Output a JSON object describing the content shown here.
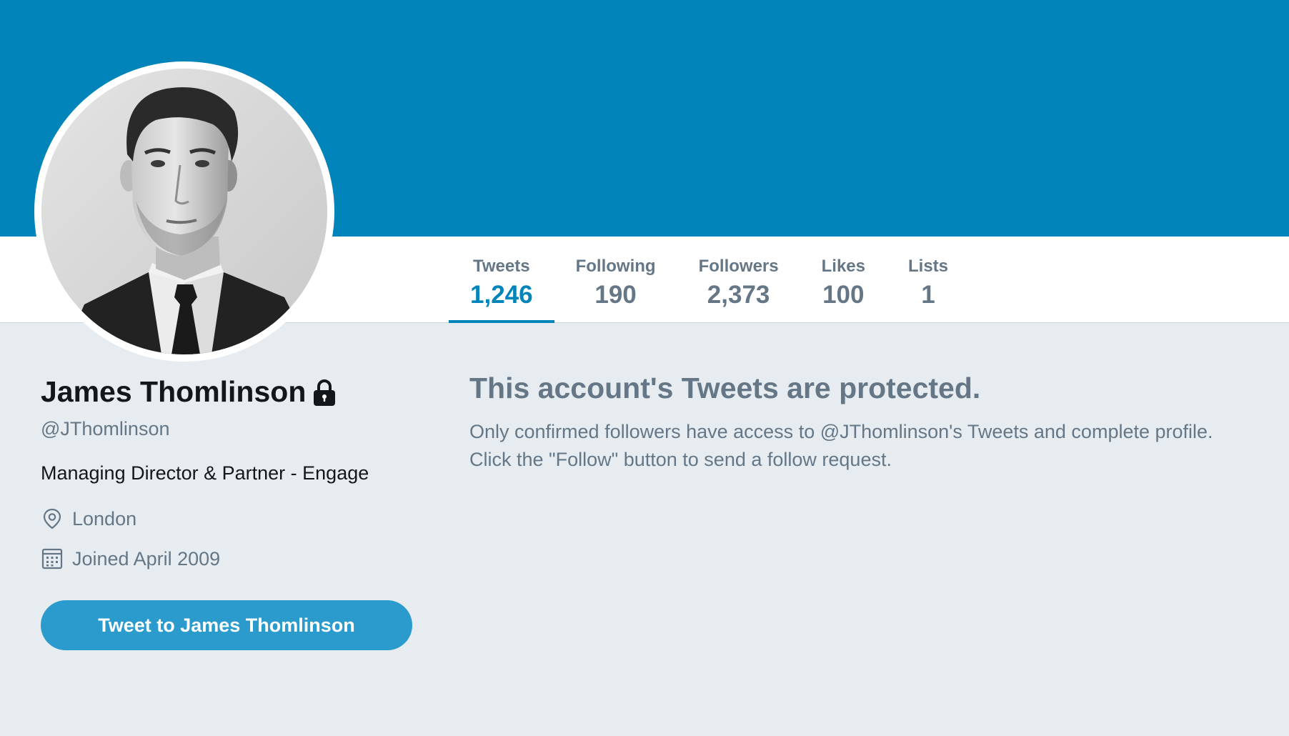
{
  "profile": {
    "name": "James Thomlinson",
    "handle": "@JThomlinson",
    "bio": "Managing Director & Partner - Engage",
    "location": "London",
    "joined": "Joined April 2009",
    "tweet_button": "Tweet to James Thomlinson"
  },
  "stats": [
    {
      "label": "Tweets",
      "value": "1,246"
    },
    {
      "label": "Following",
      "value": "190"
    },
    {
      "label": "Followers",
      "value": "2,373"
    },
    {
      "label": "Likes",
      "value": "100"
    },
    {
      "label": "Lists",
      "value": "1"
    }
  ],
  "active_tab": "Tweets",
  "protected": {
    "title": "This account's Tweets are protected.",
    "line1": "Only confirmed followers have access to @JThomlinson's Tweets and complete profile.",
    "line2": "Click the \"Follow\" button to send a follow request."
  },
  "icons": {
    "lock": "lock-icon",
    "location": "location-pin-icon",
    "calendar": "calendar-icon"
  },
  "colors": {
    "banner": "#0084ba",
    "accent": "#0084ba",
    "button": "#2b9bcd",
    "muted_text": "#657786",
    "background": "#e6ecf0"
  }
}
